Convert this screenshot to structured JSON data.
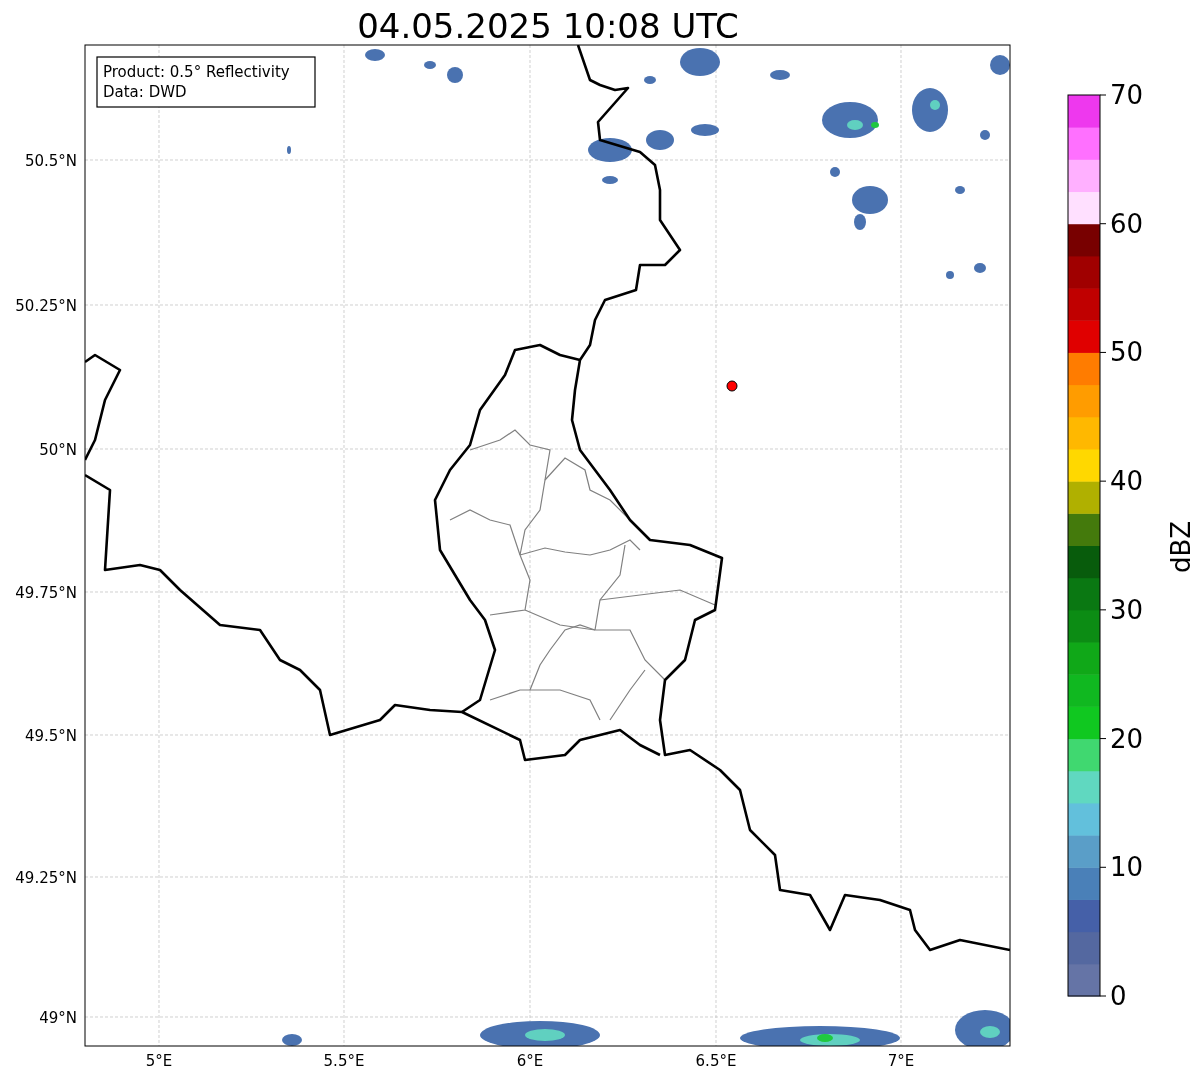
{
  "title": "04.05.2025 10:08 UTC",
  "info_box": {
    "lines": [
      "Product: 0.5° Reflectivity",
      "Data: DWD"
    ]
  },
  "map": {
    "lat_ticks": [
      "50.5°N",
      "50.25°N",
      "50°N",
      "49.75°N",
      "49.5°N",
      "49.25°N",
      "49°N"
    ],
    "lon_ticks": [
      "5°E",
      "5.5°E",
      "6°E",
      "6.5°E",
      "7°E"
    ]
  },
  "colorbar": {
    "label": "dBZ",
    "ticks": [
      "70",
      "60",
      "50",
      "40",
      "30",
      "20",
      "10",
      "0"
    ]
  }
}
